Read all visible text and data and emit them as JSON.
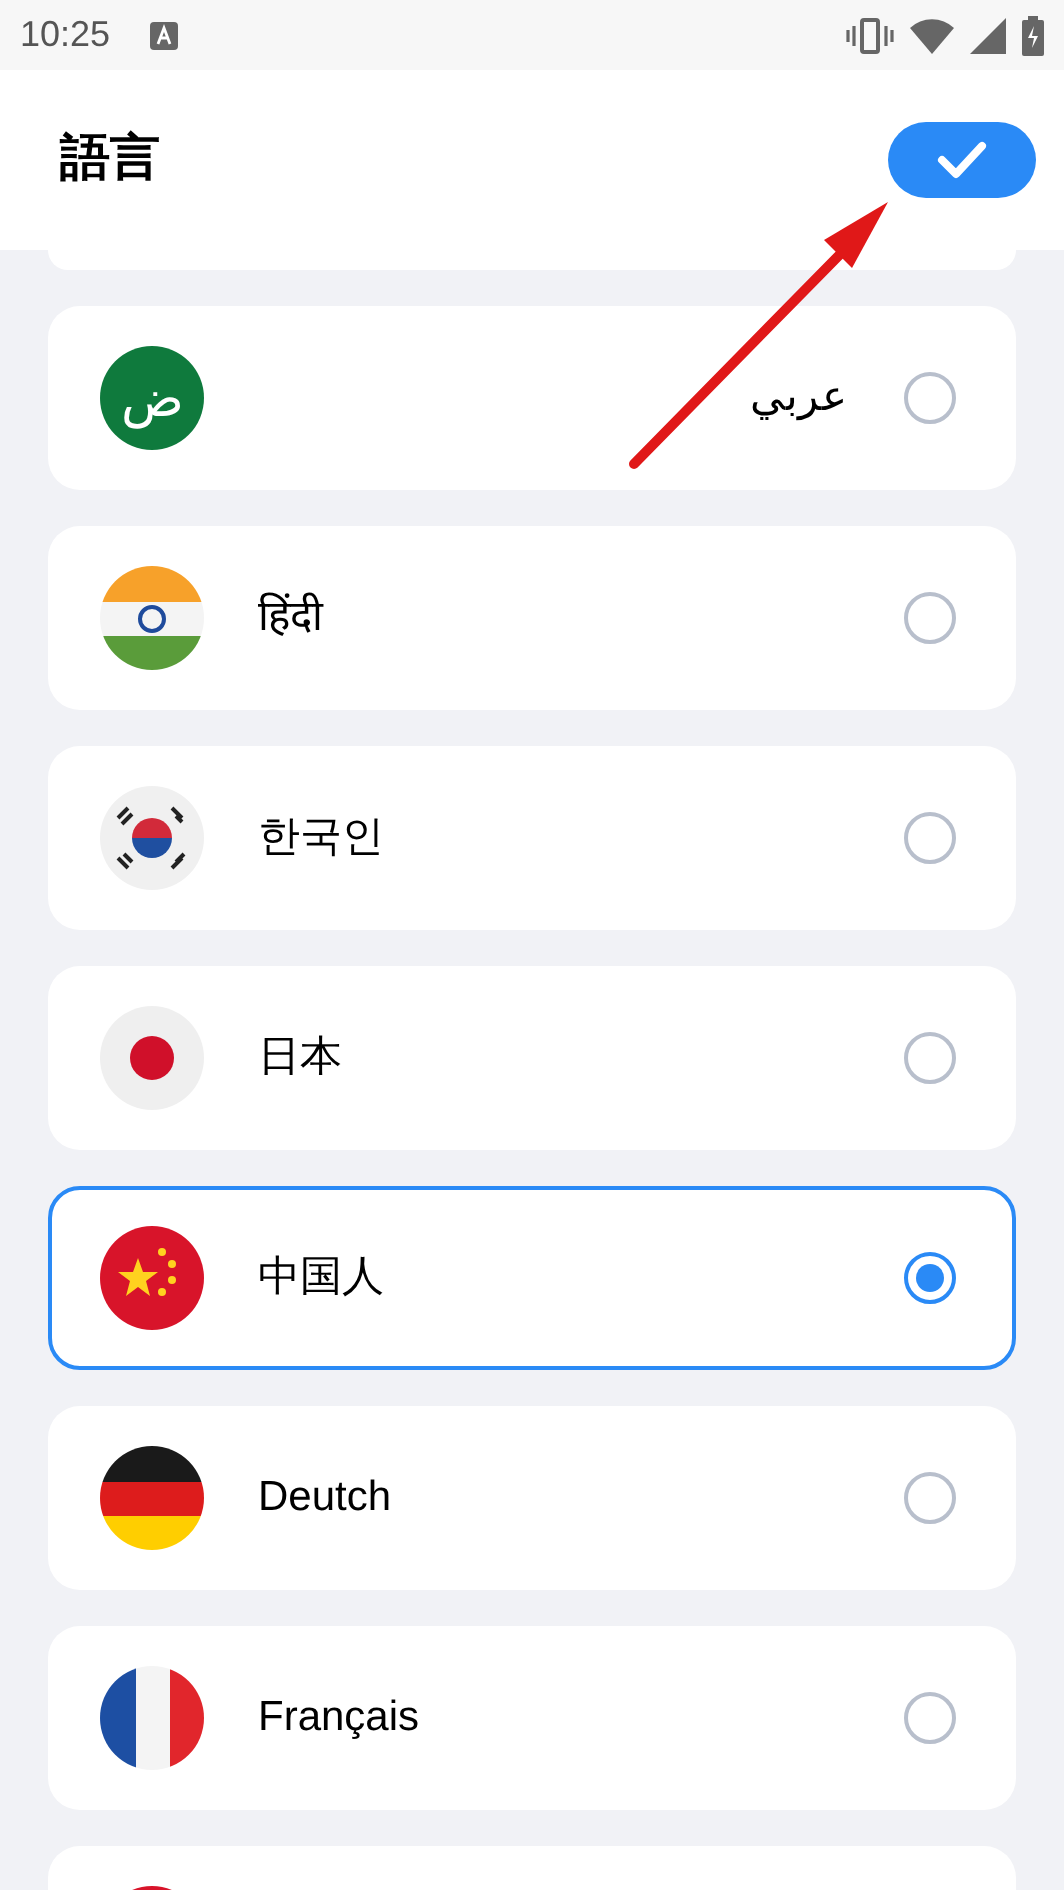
{
  "status_bar": {
    "time": "10:25"
  },
  "header": {
    "title": "語言"
  },
  "languages": [
    {
      "kind": "arabic",
      "flag_text": "ض",
      "label": "عربي",
      "selected": false
    },
    {
      "kind": "india",
      "label": "हिंदी",
      "selected": false
    },
    {
      "kind": "korea",
      "label": "한국인",
      "selected": false
    },
    {
      "kind": "japan",
      "label": "日本",
      "selected": false
    },
    {
      "kind": "china",
      "label": "中国人",
      "selected": true
    },
    {
      "kind": "germany",
      "label": "Deutch",
      "selected": false
    },
    {
      "kind": "france",
      "label": "Français",
      "selected": false
    },
    {
      "kind": "partial"
    }
  ]
}
